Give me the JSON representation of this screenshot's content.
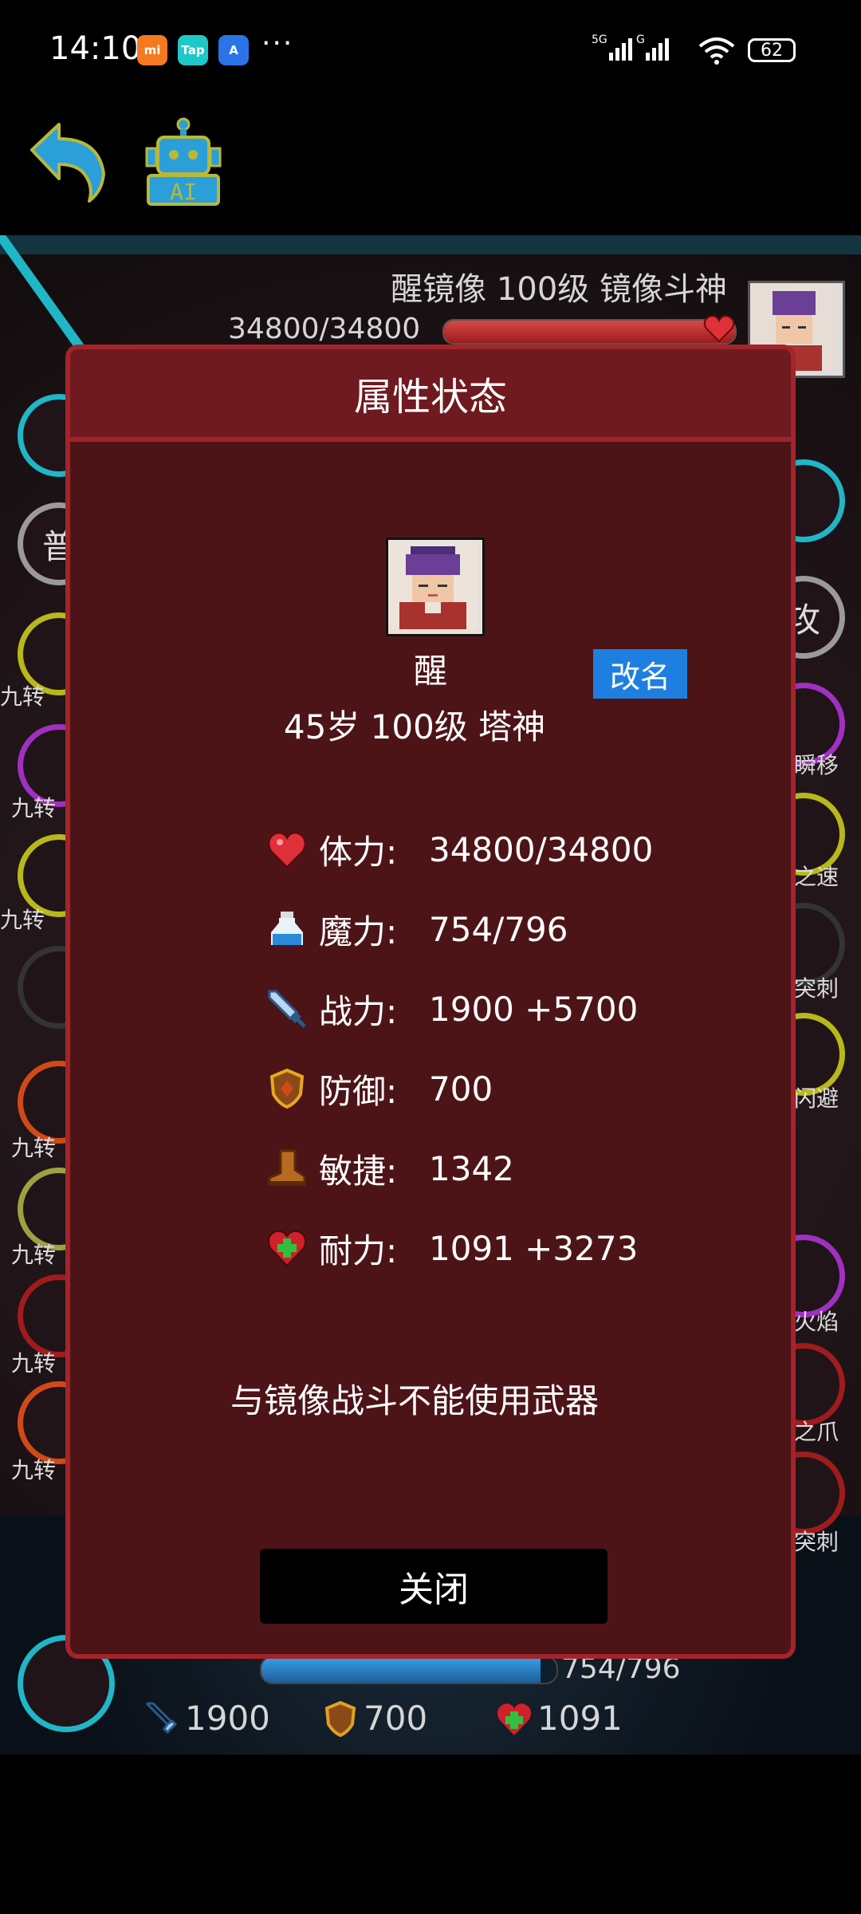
{
  "status_bar": {
    "time": "14:10",
    "app_icons": [
      {
        "name": "mi-app-icon",
        "text": "mi",
        "color": "#f47920"
      },
      {
        "name": "taptap-app-icon",
        "text": "Tap",
        "color": "#1fc7c7"
      },
      {
        "name": "browser-app-icon",
        "text": "A",
        "color": "#2a74e8"
      }
    ],
    "more": "···",
    "signal": "5G G",
    "battery": "62"
  },
  "toolbar": {
    "back_icon": "back-arrow-icon",
    "ai_icon": "ai-robot-icon",
    "ai_label": "AI"
  },
  "battle": {
    "enemy_title": "醒镜像 100级 镜像斗神",
    "enemy_hp_text": "34800/34800",
    "enemy_hp_fraction": 1.0,
    "left_skills": [
      {
        "icon": "",
        "label": ""
      },
      {
        "icon": "普",
        "label": ""
      },
      {
        "icon": "",
        "label": "九转"
      },
      {
        "icon": "",
        "label": "九转"
      },
      {
        "icon": "",
        "label": "九转"
      },
      {
        "icon": "",
        "label": ""
      },
      {
        "icon": "",
        "label": "九转"
      },
      {
        "icon": "",
        "label": "九转"
      },
      {
        "icon": "",
        "label": "九转"
      },
      {
        "icon": "",
        "label": "九转"
      }
    ],
    "right_skills": [
      {
        "icon": "",
        "label": ""
      },
      {
        "icon": "攻",
        "label": ""
      },
      {
        "icon": "",
        "label": "瞬移"
      },
      {
        "icon": "",
        "label": "之速"
      },
      {
        "icon": "",
        "label": "突刺"
      },
      {
        "icon": "",
        "label": "闪避"
      },
      {
        "icon": "",
        "label": "火焰"
      },
      {
        "icon": "",
        "label": "之爪"
      },
      {
        "icon": "",
        "label": "突刺"
      }
    ],
    "player_mp_text": "754/796",
    "player_mp_fraction": 0.947,
    "player_stats": {
      "attack": "1900",
      "defense": "700",
      "stamina": "1091"
    }
  },
  "modal": {
    "title": "属性状态",
    "char_name": "醒",
    "rename_label": "改名",
    "char_info": "45岁 100级 塔神",
    "stats": [
      {
        "icon": "heart-icon",
        "label": "体力:",
        "value": "34800/34800"
      },
      {
        "icon": "mana-potion-icon",
        "label": "魔力:",
        "value": "754/796"
      },
      {
        "icon": "sword-icon",
        "label": "战力:",
        "value": "1900 +5700"
      },
      {
        "icon": "shield-icon",
        "label": "防御:",
        "value": "700"
      },
      {
        "icon": "boot-icon",
        "label": "敏捷:",
        "value": "1342"
      },
      {
        "icon": "health-cross-icon",
        "label": "耐力:",
        "value": "1091 +3273"
      }
    ],
    "note": "与镜像战斗不能使用武器",
    "close_label": "关闭"
  },
  "colors": {
    "modal_bg": "#4d1418",
    "modal_border": "#a3242a",
    "rename_button": "#1e7fe0"
  }
}
